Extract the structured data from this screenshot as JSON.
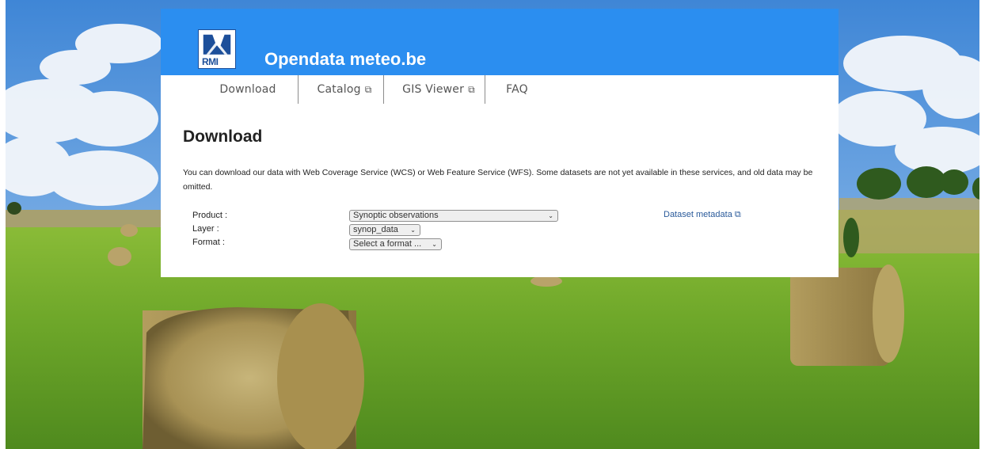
{
  "site": {
    "title": "Opendata meteo.be",
    "logo_text": "RMI"
  },
  "nav": {
    "items": [
      {
        "label": "Download",
        "external": false
      },
      {
        "label": "Catalog",
        "external": true
      },
      {
        "label": "GIS Viewer",
        "external": true
      },
      {
        "label": "FAQ",
        "external": false
      }
    ],
    "external_glyph": "⧉"
  },
  "page": {
    "title": "Download",
    "intro": "You can download our data with Web Coverage Service (WCS) or Web Feature Service (WFS). Some datasets are not yet available in these services, and old data may be omitted."
  },
  "form": {
    "product_label": "Product :",
    "product_value": "Synoptic observations",
    "layer_label": "Layer :",
    "layer_value": "synop_data",
    "format_label": "Format :",
    "format_value": "Select a format ...",
    "arrow_glyph": "⌄"
  },
  "links": {
    "dataset_metadata": "Dataset metadata"
  },
  "colors": {
    "banner": "#2b8ef0",
    "link": "#2a5a9a",
    "sky": "#6aa6e0",
    "grass": "#6fae2c"
  }
}
